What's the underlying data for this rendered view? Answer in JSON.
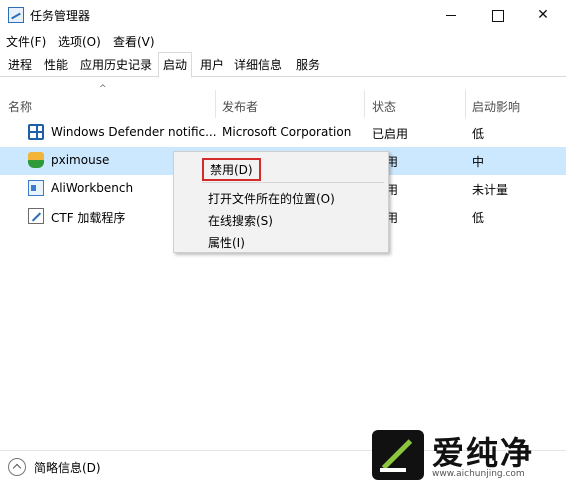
{
  "window": {
    "title": "任务管理器",
    "controls": {
      "minimize_icon": "minimize-icon",
      "maximize_icon": "maximize-icon",
      "close_symbol": "✕"
    }
  },
  "menubar": {
    "file": "文件(F)",
    "options": "选项(O)",
    "view": "查看(V)"
  },
  "tabs": [
    {
      "label": "进程"
    },
    {
      "label": "性能"
    },
    {
      "label": "应用历史记录"
    },
    {
      "label": "启动",
      "active": true
    },
    {
      "label": "用户"
    },
    {
      "label": "详细信息"
    },
    {
      "label": "服务"
    }
  ],
  "columns": {
    "name": "名称",
    "publisher": "发布者",
    "status": "状态",
    "impact": "启动影响",
    "sort_indicator": "^"
  },
  "rows": [
    {
      "icon": "shield-icon",
      "name": "Windows Defender notific...",
      "publisher": "Microsoft Corporation",
      "status": "已启用",
      "impact": "低"
    },
    {
      "icon": "mouse-icon",
      "name": "pximouse",
      "publisher": "",
      "status": "用",
      "impact": "中",
      "selected": true
    },
    {
      "icon": "app-window-icon",
      "name": "AliWorkbench",
      "publisher": "",
      "status": "用",
      "impact": "未计量"
    },
    {
      "icon": "pen-icon",
      "name": "CTF 加载程序",
      "publisher": "",
      "status": "用",
      "impact": "低"
    }
  ],
  "context_menu": {
    "items": [
      "禁用(D)",
      "打开文件所在的位置(O)",
      "在线搜索(S)",
      "属性(I)"
    ],
    "highlight_color": "#d32a2a"
  },
  "footer": {
    "label": "简略信息(D)"
  },
  "watermark": {
    "text": "爱纯净",
    "url": "www.aichunjing.com",
    "accent": "#8cc63e"
  },
  "colors": {
    "selected_row": "#cce8ff"
  }
}
